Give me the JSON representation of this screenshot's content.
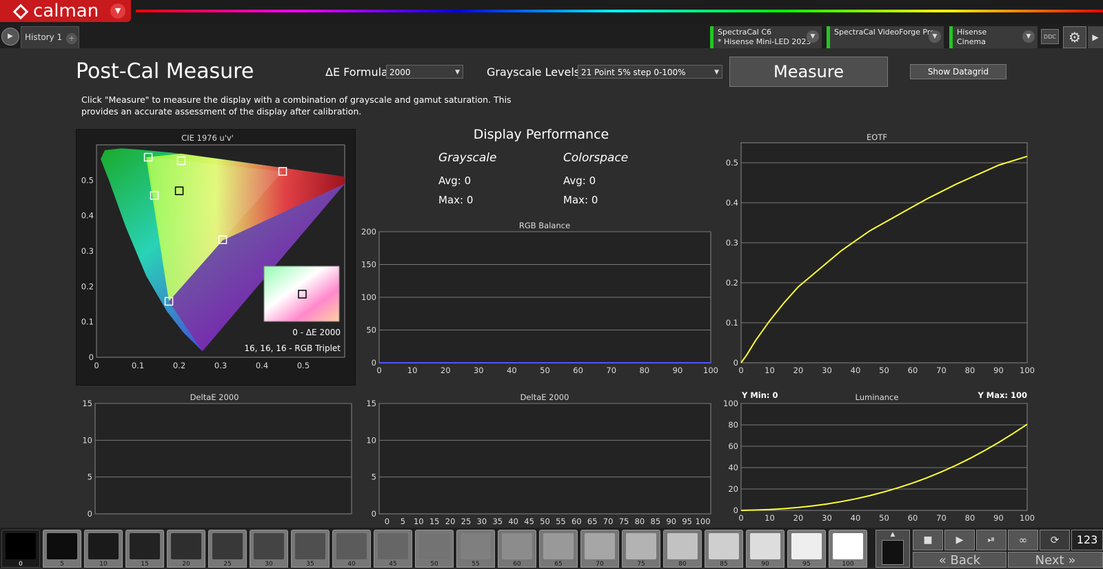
{
  "app": {
    "logo_text": "calman",
    "tabs": [
      {
        "label": "History 1"
      }
    ],
    "add_tab_symbol": "+",
    "devices": [
      {
        "line1": "SpectraCal C6",
        "line2": "* Hisense Mini-LED 2023"
      },
      {
        "line1": "SpectraCal VideoForge Pro",
        "line2": ""
      },
      {
        "line1": "Hisense",
        "line2": "Cinema"
      }
    ],
    "ddc_label": "DDC",
    "status_color": "#22c722",
    "brand_color": "#c8191c"
  },
  "header": {
    "title": "Post-Cal Measure",
    "de_formula_label": "ΔE Formula",
    "de_formula_value": "2000",
    "grayscale_label": "Grayscale Levels",
    "grayscale_value": "21 Point 5% step 0-100%",
    "measure_button": "Measure",
    "datagrid_button": "Show Datagrid",
    "description": "Click \"Measure\" to measure the display with a combination of grayscale and gamut saturation.  This provides an accurate assessment of the display after calibration."
  },
  "performance": {
    "title": "Display Performance",
    "grayscale": {
      "heading": "Grayscale",
      "avg": "Avg: 0",
      "max": "Max: 0"
    },
    "colorspace": {
      "heading": "Colorspace",
      "avg": "Avg: 0",
      "max": "Max: 0"
    }
  },
  "cie_info": {
    "de_text": "0 - ΔE 2000",
    "rgb_text": "16, 16, 16 - RGB Triplet"
  },
  "luminance_info": {
    "ymin": "Y Min: 0",
    "ymax": "Y Max: 100"
  },
  "chart_data": [
    {
      "type": "scatter",
      "title": "CIE 1976 u'v'",
      "xlim": [
        0,
        0.6
      ],
      "ylim": [
        0,
        0.6
      ],
      "x_ticks": [
        "0",
        "0.1",
        "0.2",
        "0.3",
        "0.4",
        "0.5"
      ],
      "y_ticks": [
        "0",
        "0.1",
        "0.2",
        "0.3",
        "0.4",
        "0.5"
      ],
      "targets": [
        {
          "u": 0.125,
          "v": 0.565
        },
        {
          "u": 0.205,
          "v": 0.555
        },
        {
          "u": 0.45,
          "v": 0.525
        },
        {
          "u": 0.2,
          "v": 0.47
        },
        {
          "u": 0.14,
          "v": 0.457
        },
        {
          "u": 0.305,
          "v": 0.332
        },
        {
          "u": 0.175,
          "v": 0.158
        }
      ]
    },
    {
      "type": "line",
      "title": "RGB Balance",
      "xlim": [
        0,
        100
      ],
      "ylim": [
        0,
        200
      ],
      "x_ticks": [
        "0",
        "10",
        "20",
        "30",
        "40",
        "50",
        "60",
        "70",
        "80",
        "90",
        "100"
      ],
      "y_ticks": [
        "0",
        "50",
        "100",
        "150",
        "200"
      ],
      "series": [
        {
          "color": "#4f55ff",
          "x": [
            0,
            100
          ],
          "y": [
            0,
            0
          ]
        }
      ]
    },
    {
      "type": "line",
      "title": "EOTF",
      "xlim": [
        0,
        100
      ],
      "ylim": [
        0,
        0.55
      ],
      "x_ticks": [
        "0",
        "10",
        "20",
        "30",
        "40",
        "50",
        "60",
        "70",
        "80",
        "90",
        "100"
      ],
      "y_ticks": [
        "0",
        "0.1",
        "0.2",
        "0.3",
        "0.4",
        "0.5"
      ],
      "series": [
        {
          "color": "#ffff33",
          "x": [
            0,
            2,
            5,
            8,
            10,
            15,
            20,
            25,
            30,
            35,
            40,
            45,
            50,
            55,
            60,
            65,
            70,
            75,
            80,
            85,
            90,
            95,
            100
          ],
          "y": [
            0,
            0.02,
            0.055,
            0.085,
            0.105,
            0.15,
            0.19,
            0.22,
            0.25,
            0.28,
            0.305,
            0.33,
            0.35,
            0.37,
            0.39,
            0.41,
            0.428,
            0.446,
            0.462,
            0.478,
            0.494,
            0.505,
            0.516
          ]
        }
      ]
    },
    {
      "type": "bar",
      "title": "DeltaE 2000",
      "ylim": [
        0,
        15
      ],
      "y_ticks": [
        "0",
        "5",
        "10",
        "15"
      ],
      "values": []
    },
    {
      "type": "bar",
      "title": "DeltaE 2000",
      "ylim": [
        0,
        15
      ],
      "y_ticks": [
        "0",
        "5",
        "10",
        "15"
      ],
      "x_ticks": [
        "0",
        "5",
        "10",
        "15",
        "20",
        "25",
        "30",
        "35",
        "40",
        "45",
        "50",
        "55",
        "60",
        "65",
        "70",
        "75",
        "80",
        "85",
        "90",
        "95",
        "100"
      ],
      "values": []
    },
    {
      "type": "line",
      "title": "Luminance",
      "xlim": [
        0,
        100
      ],
      "ylim": [
        0,
        100
      ],
      "x_ticks": [
        "0",
        "10",
        "20",
        "30",
        "40",
        "50",
        "60",
        "70",
        "80",
        "90",
        "100"
      ],
      "y_ticks": [
        "0",
        "20",
        "40",
        "60",
        "80",
        "100"
      ],
      "series": [
        {
          "color": "#ffff33",
          "x": [
            0,
            5,
            10,
            15,
            20,
            25,
            30,
            35,
            40,
            45,
            50,
            55,
            60,
            65,
            70,
            75,
            80,
            85,
            90,
            95,
            100
          ],
          "y": [
            0,
            0.3,
            0.8,
            1.6,
            2.7,
            4.2,
            6,
            8.2,
            10.8,
            13.8,
            17.3,
            21.2,
            25.6,
            30.5,
            36,
            42,
            48.6,
            55.8,
            63.5,
            71.8,
            80.5
          ]
        }
      ]
    }
  ],
  "patches": [
    {
      "label": "0",
      "color": "#000000"
    },
    {
      "label": "5",
      "color": "#0d0d0d"
    },
    {
      "label": "10",
      "color": "#1a1a1a"
    },
    {
      "label": "15",
      "color": "#222222"
    },
    {
      "label": "20",
      "color": "#2e2e2e"
    },
    {
      "label": "25",
      "color": "#383838"
    },
    {
      "label": "30",
      "color": "#444444"
    },
    {
      "label": "35",
      "color": "#4f4f4f"
    },
    {
      "label": "40",
      "color": "#5b5b5b"
    },
    {
      "label": "45",
      "color": "#666666"
    },
    {
      "label": "50",
      "color": "#737373"
    },
    {
      "label": "55",
      "color": "#7f7f7f"
    },
    {
      "label": "60",
      "color": "#8c8c8c"
    },
    {
      "label": "65",
      "color": "#999999"
    },
    {
      "label": "70",
      "color": "#a6a6a6"
    },
    {
      "label": "75",
      "color": "#b3b3b3"
    },
    {
      "label": "80",
      "color": "#c2c2c2"
    },
    {
      "label": "85",
      "color": "#cfcfcf"
    },
    {
      "label": "90",
      "color": "#dddddd"
    },
    {
      "label": "95",
      "color": "#eeeeee"
    },
    {
      "label": "100",
      "color": "#ffffff"
    }
  ],
  "footer": {
    "counter": "123",
    "back_label": "Back",
    "next_label": "Next"
  }
}
